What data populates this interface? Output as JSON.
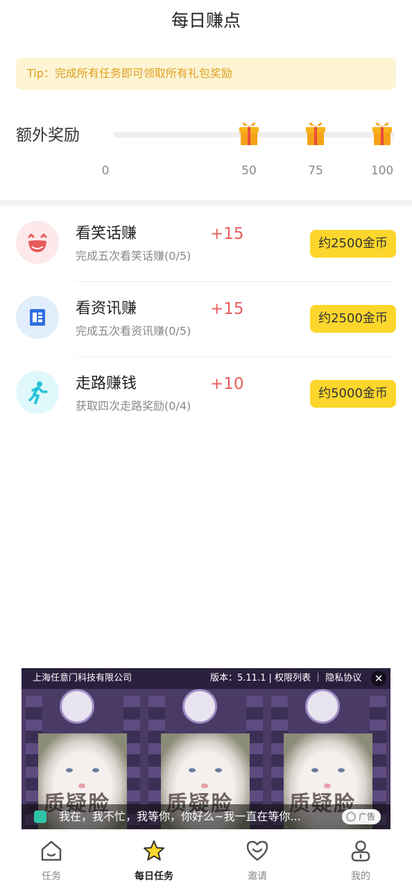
{
  "header": {
    "title": "每日赚点"
  },
  "tip": {
    "text": "Tip：完成所有任务即可领取所有礼包奖励"
  },
  "bonus": {
    "label": "额外奖励",
    "ticks": [
      "0",
      "50",
      "75",
      "100"
    ]
  },
  "tasks": [
    {
      "name": "看笑话赚",
      "desc": "完成五次看笑话赚(0/5)",
      "points": "+15",
      "reward": "约2500金币",
      "icon": "laughing-face-icon",
      "icon_color": "#e85a5a",
      "bg": "#fde9ea"
    },
    {
      "name": "看资讯赚",
      "desc": "完成五次看资讯赚(0/5)",
      "points": "+15",
      "reward": "约2500金币",
      "icon": "news-icon",
      "icon_color": "#2f6fe0",
      "bg": "#e3eefc"
    },
    {
      "name": "走路赚钱",
      "desc": "获取四次走路奖励(0/4)",
      "points": "+10",
      "reward": "约5000金币",
      "icon": "walking-icon",
      "icon_color": "#25c4d8",
      "bg": "#e0f8fb"
    }
  ],
  "ad": {
    "company": "上海任意门科技有限公司",
    "version": "版本：5.11.1 | 权限列表 ｜ 隐私协议",
    "caption": "我在，我不忙，我等你，你好么~我一直在等你...",
    "overlay_text": "质疑脸",
    "badge": "广告"
  },
  "tabbar": {
    "items": [
      {
        "label": "任务",
        "icon": "home-icon"
      },
      {
        "label": "每日任务",
        "icon": "star-icon",
        "active": true
      },
      {
        "label": "邀请",
        "icon": "heart-smile-icon"
      },
      {
        "label": "我的",
        "icon": "profile-icon"
      }
    ]
  },
  "colors": {
    "accent_yellow": "#fcd62c",
    "points_red": "#e85c5c",
    "tip_bg": "#fdf4d3",
    "tip_text": "#e0a020"
  }
}
